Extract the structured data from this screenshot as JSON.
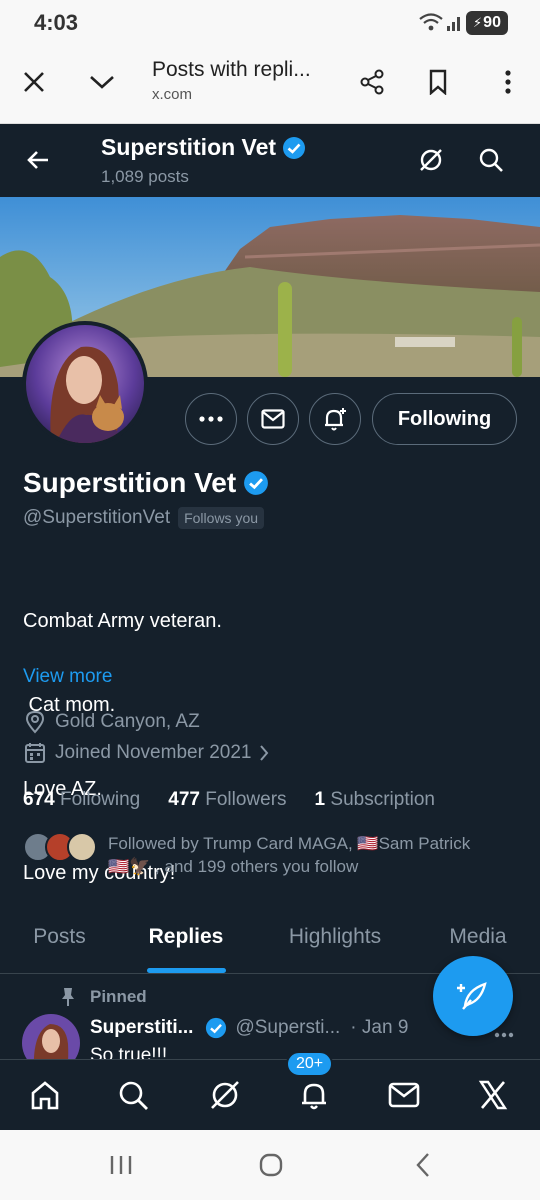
{
  "status": {
    "time": "4:03",
    "battery": "90"
  },
  "browser": {
    "title": "Posts with repli...",
    "url": "x.com"
  },
  "header": {
    "name": "Superstition Vet",
    "posts_count": "1,089 posts"
  },
  "profile": {
    "name": "Superstition Vet",
    "handle": "@SuperstitionVet",
    "follows_you": "Follows you",
    "following_button": "Following",
    "bio": [
      "Combat Army veteran.",
      " Cat mom.",
      "Love AZ.",
      "Love my country!"
    ],
    "view_more": "View more",
    "location": "Gold Canyon, AZ",
    "joined": "Joined November 2021",
    "stats": {
      "following_count": "674",
      "following_label": "Following",
      "followers_count": "477",
      "followers_label": "Followers",
      "subscription_count": "1",
      "subscription_label": "Subscription"
    },
    "followed_by_line1": "Followed by Trump Card MAGA, 🇺🇸Sam Patrick",
    "followed_by_line2": "🇺🇸🦅 , and 199 others you follow"
  },
  "tabs": [
    "Posts",
    "Replies",
    "Highlights",
    "Media"
  ],
  "active_tab": "Replies",
  "pinned_post": {
    "pinned_label": "Pinned",
    "name": "Superstiti...",
    "handle": "@Supersti...",
    "date": "· Jan 9",
    "text": "So true!!!"
  },
  "notifications_badge": "20+",
  "colors": {
    "background": "#15202b",
    "accent": "#1d9bf0",
    "muted": "#8b98a5"
  }
}
